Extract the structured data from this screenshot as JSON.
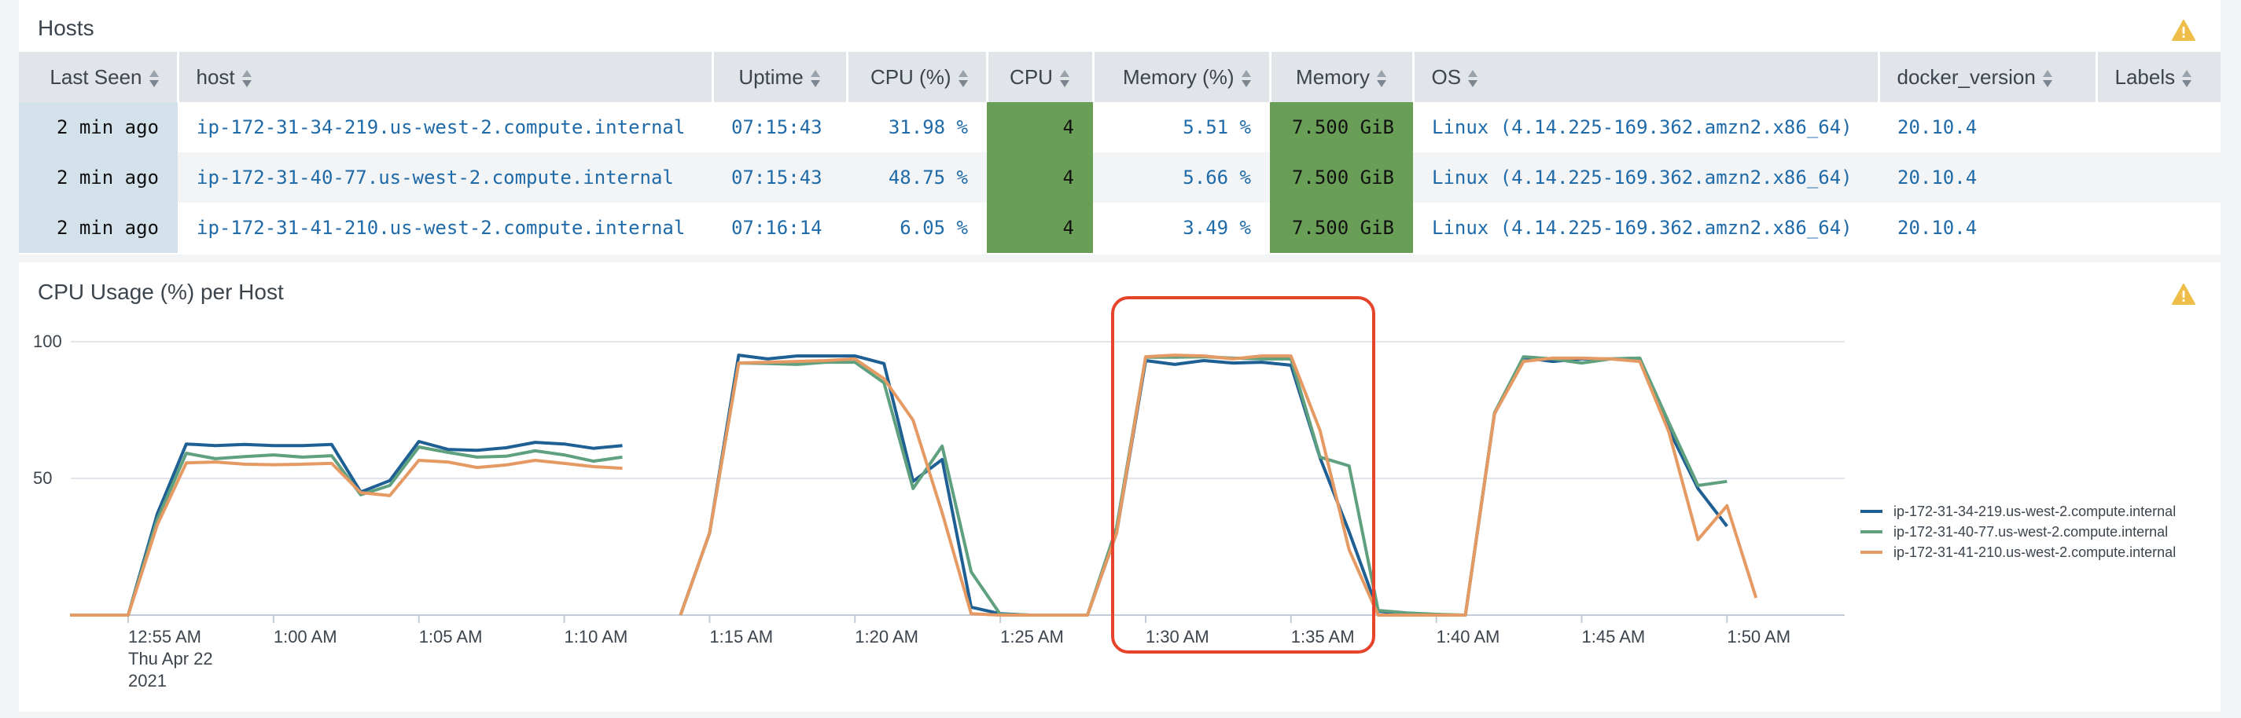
{
  "hosts_panel": {
    "title": "Hosts",
    "warning_icon": "warning-icon",
    "columns": [
      {
        "label": "Last Seen",
        "sortable": true
      },
      {
        "label": "host",
        "sortable": true
      },
      {
        "label": "Uptime",
        "sortable": true
      },
      {
        "label": "CPU (%)",
        "sortable": true
      },
      {
        "label": "CPU",
        "sortable": true
      },
      {
        "label": "Memory (%)",
        "sortable": true
      },
      {
        "label": "Memory",
        "sortable": true
      },
      {
        "label": "OS",
        "sortable": true
      },
      {
        "label": "docker_version",
        "sortable": true
      },
      {
        "label": "Labels",
        "sortable": true
      }
    ],
    "rows": [
      {
        "last_seen": "2 min ago",
        "host": "ip-172-31-34-219.us-west-2.compute.internal",
        "uptime": "07:15:43",
        "cpu_pct": "31.98 %",
        "cpu": "4",
        "mem_pct": "5.51 %",
        "memory": "7.500 GiB",
        "os": "Linux (4.14.225-169.362.amzn2.x86_64)",
        "docker_version": "20.10.4",
        "labels": ""
      },
      {
        "last_seen": "2 min ago",
        "host": "ip-172-31-40-77.us-west-2.compute.internal",
        "uptime": "07:15:43",
        "cpu_pct": "48.75 %",
        "cpu": "4",
        "mem_pct": "5.66 %",
        "memory": "7.500 GiB",
        "os": "Linux (4.14.225-169.362.amzn2.x86_64)",
        "docker_version": "20.10.4",
        "labels": ""
      },
      {
        "last_seen": "2 min ago",
        "host": "ip-172-31-41-210.us-west-2.compute.internal",
        "uptime": "07:16:14",
        "cpu_pct": "6.05 %",
        "cpu": "4",
        "mem_pct": "3.49 %",
        "memory": "7.500 GiB",
        "os": "Linux (4.14.225-169.362.amzn2.x86_64)",
        "docker_version": "20.10.4",
        "labels": ""
      }
    ],
    "colors": {
      "cell_green": "#699e57",
      "last_seen_bg": "#d3e2ea",
      "link": "#1f6aa8"
    }
  },
  "chart_panel": {
    "title": "CPU Usage (%) per Host",
    "warning_icon": "warning-icon",
    "highlight_color": "#e6432a"
  },
  "chart_data": {
    "type": "line",
    "title": "CPU Usage (%) per Host",
    "xlabel": "",
    "ylabel": "",
    "ylim": [
      0,
      100
    ],
    "y_ticks": [
      50,
      100
    ],
    "grid": true,
    "legend_position": "right",
    "x_start_label": "12:53",
    "x_range_minutes": [
      -2,
      59
    ],
    "x_ticks": [
      {
        "minute": 0,
        "label": "12:55 AM",
        "sublabels": [
          "Thu Apr 22",
          "2021"
        ]
      },
      {
        "minute": 5,
        "label": "1:00 AM"
      },
      {
        "minute": 10,
        "label": "1:05 AM"
      },
      {
        "minute": 15,
        "label": "1:10 AM"
      },
      {
        "minute": 20,
        "label": "1:15 AM"
      },
      {
        "minute": 25,
        "label": "1:20 AM"
      },
      {
        "minute": 30,
        "label": "1:25 AM"
      },
      {
        "minute": 35,
        "label": "1:30 AM"
      },
      {
        "minute": 40,
        "label": "1:35 AM"
      },
      {
        "minute": 45,
        "label": "1:40 AM"
      },
      {
        "minute": 50,
        "label": "1:45 AM"
      },
      {
        "minute": 55,
        "label": "1:50 AM"
      }
    ],
    "x": [
      "12:53",
      "12:54",
      "12:55",
      "12:56",
      "12:57",
      "12:58",
      "12:59",
      "1:00",
      "1:01",
      "1:02",
      "1:03",
      "1:04",
      "1:05",
      "1:06",
      "1:07",
      "1:08",
      "1:09",
      "1:10",
      "1:11",
      "1:12",
      "1:13",
      "1:14",
      "1:15",
      "1:16",
      "1:17",
      "1:18",
      "1:19",
      "1:20",
      "1:21",
      "1:22",
      "1:23",
      "1:24",
      "1:25",
      "1:26",
      "1:27",
      "1:28",
      "1:29",
      "1:30",
      "1:31",
      "1:32",
      "1:33",
      "1:34",
      "1:35",
      "1:36",
      "1:37",
      "1:38",
      "1:39",
      "1:40",
      "1:41",
      "1:42",
      "1:43",
      "1:44",
      "1:45",
      "1:46",
      "1:47",
      "1:48",
      "1:49",
      "1:50",
      "1:51"
    ],
    "series": [
      {
        "name": "ip-172-31-34-219.us-west-2.compute.internal",
        "color": "#1e5f94",
        "values": [
          0,
          0,
          0,
          37,
          62.6,
          62,
          62.4,
          62,
          62,
          62.4,
          45,
          49.2,
          63.5,
          60.6,
          60.3,
          61.2,
          63.2,
          62.6,
          61,
          62,
          null,
          0,
          30,
          95.1,
          93.7,
          94.8,
          94.8,
          94.8,
          92,
          48.9,
          56.9,
          2.9,
          0.5,
          0,
          0,
          0,
          30,
          93.1,
          91.7,
          93.1,
          92.2,
          92.5,
          91.4,
          57.5,
          30.5,
          1.4,
          0.5,
          0,
          0,
          73.6,
          94.2,
          92.8,
          93.7,
          93.7,
          94,
          67.8,
          46.3,
          32.5,
          null
        ]
      },
      {
        "name": "ip-172-31-40-77.us-west-2.compute.internal",
        "color": "#5fa07f",
        "values": [
          0,
          0,
          0,
          35,
          59.2,
          57.2,
          58,
          58.6,
          57.8,
          58.3,
          44,
          47.4,
          61.5,
          59.5,
          57.8,
          58.1,
          60.1,
          58.6,
          56.3,
          57.8,
          null,
          0,
          30,
          92.2,
          92,
          91.7,
          92.5,
          92.5,
          85,
          46.3,
          61.8,
          15.8,
          0.3,
          0,
          0,
          0,
          32,
          94.3,
          94.3,
          94.5,
          94,
          93.7,
          93.7,
          57.8,
          54.6,
          1.7,
          0.8,
          0.3,
          0,
          74,
          94.5,
          93.7,
          92.2,
          93.7,
          94,
          70.4,
          47.4,
          48.9,
          null
        ]
      },
      {
        "name": "ip-172-31-41-210.us-west-2.compute.internal",
        "color": "#e69a63",
        "values": [
          0,
          0,
          0,
          33,
          55.7,
          56,
          55.2,
          55,
          55.2,
          55.5,
          44.8,
          43.7,
          56.6,
          56,
          54,
          54.9,
          56.6,
          55.5,
          54.3,
          53.7,
          null,
          0,
          30,
          92.2,
          92.5,
          92.8,
          93.1,
          93.7,
          86.5,
          71.3,
          37.4,
          0.5,
          0,
          0,
          0,
          0,
          30,
          94.5,
          95.1,
          94.8,
          93.7,
          94.8,
          94.8,
          67.5,
          23.9,
          0,
          0,
          0,
          0,
          73.6,
          92.8,
          94,
          94,
          93.7,
          92.8,
          67,
          27.6,
          40,
          6.3
        ]
      }
    ]
  }
}
